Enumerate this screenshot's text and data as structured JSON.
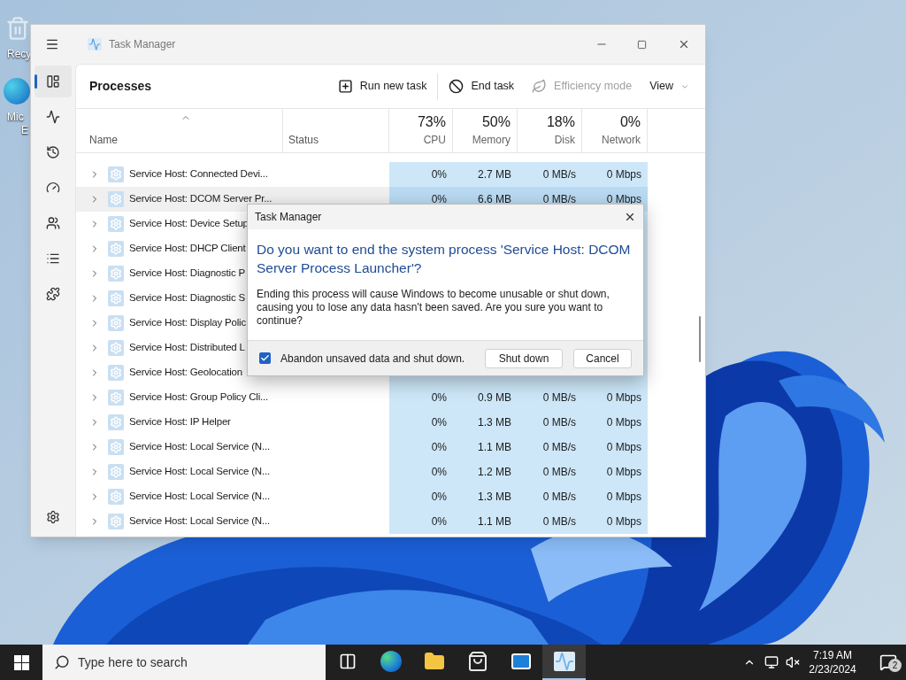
{
  "desktop": {
    "icons": [
      {
        "kind": "recycle",
        "lines": [
          "Recy"
        ]
      },
      {
        "kind": "edge",
        "lines": [
          "Mic",
          "E"
        ]
      }
    ]
  },
  "window": {
    "title": "Task Manager",
    "nav": [
      {
        "kind": "processes",
        "selected": true
      },
      {
        "kind": "performance",
        "selected": false
      },
      {
        "kind": "history",
        "selected": false
      },
      {
        "kind": "startup",
        "selected": false
      },
      {
        "kind": "users",
        "selected": false
      },
      {
        "kind": "details",
        "selected": false
      },
      {
        "kind": "services",
        "selected": false
      }
    ],
    "page_title": "Processes",
    "actions": [
      {
        "kind": "run",
        "label": "Run new task",
        "disabled": false
      },
      {
        "kind": "end",
        "label": "End task",
        "disabled": false
      },
      {
        "kind": "efficiency",
        "label": "Efficiency mode",
        "disabled": true
      },
      {
        "kind": "view",
        "label": "View",
        "disabled": false
      }
    ]
  },
  "table": {
    "columns": [
      {
        "label": "Name"
      },
      {
        "label": "Status"
      },
      {
        "percent": "73%",
        "label": "CPU"
      },
      {
        "percent": "50%",
        "label": "Memory"
      },
      {
        "percent": "18%",
        "label": "Disk"
      },
      {
        "percent": "0%",
        "label": "Network"
      }
    ],
    "rows": [
      {
        "name": "Service Host: Connected Devi...",
        "selected": false,
        "cpu": "0%",
        "memory": "2.7 MB",
        "disk": "0 MB/s",
        "network": "0 Mbps"
      },
      {
        "name": "Service Host: DCOM Server Pr...",
        "selected": true,
        "cpu": "0%",
        "memory": "6.6 MB",
        "disk": "0 MB/s",
        "network": "0 Mbps"
      },
      {
        "name": "Service Host: Device Setup",
        "selected": false
      },
      {
        "name": "Service Host: DHCP Client",
        "selected": false
      },
      {
        "name": "Service Host: Diagnostic P",
        "selected": false
      },
      {
        "name": "Service Host: Diagnostic S",
        "selected": false
      },
      {
        "name": "Service Host: Display Polic",
        "selected": false
      },
      {
        "name": "Service Host: Distributed L",
        "selected": false
      },
      {
        "name": "Service Host: Geolocation",
        "selected": false
      },
      {
        "name": "Service Host: Group Policy Cli...",
        "selected": false,
        "cpu": "0%",
        "memory": "0.9 MB",
        "disk": "0 MB/s",
        "network": "0 Mbps"
      },
      {
        "name": "Service Host: IP Helper",
        "selected": false,
        "cpu": "0%",
        "memory": "1.3 MB",
        "disk": "0 MB/s",
        "network": "0 Mbps"
      },
      {
        "name": "Service Host: Local Service (N...",
        "selected": false,
        "cpu": "0%",
        "memory": "1.1 MB",
        "disk": "0 MB/s",
        "network": "0 Mbps"
      },
      {
        "name": "Service Host: Local Service (N...",
        "selected": false,
        "cpu": "0%",
        "memory": "1.2 MB",
        "disk": "0 MB/s",
        "network": "0 Mbps"
      },
      {
        "name": "Service Host: Local Service (N...",
        "selected": false,
        "cpu": "0%",
        "memory": "1.3 MB",
        "disk": "0 MB/s",
        "network": "0 Mbps"
      },
      {
        "name": "Service Host: Local Service (N...",
        "selected": false,
        "cpu": "0%",
        "memory": "1.1 MB",
        "disk": "0 MB/s",
        "network": "0 Mbps"
      }
    ]
  },
  "dialog": {
    "title": "Task Manager",
    "heading": "Do you want to end the system process 'Service Host: DCOM Server Process Launcher'?",
    "message": "Ending this process will cause Windows to become unusable or shut down, causing you to lose any data hasn't been saved. Are you sure you want to continue?",
    "checkbox": {
      "label": "Abandon unsaved data and shut down.",
      "checked": true
    },
    "buttons": [
      "Shut down",
      "Cancel"
    ]
  },
  "taskbar": {
    "search_placeholder": "Type here to search",
    "apps": [
      {
        "kind": "taskview",
        "selected": false
      },
      {
        "kind": "edge",
        "selected": false
      },
      {
        "kind": "explorer",
        "selected": false
      },
      {
        "kind": "store",
        "selected": false
      },
      {
        "kind": "mail",
        "selected": false
      },
      {
        "kind": "taskmanager",
        "selected": true
      }
    ],
    "time": "7:19 AM",
    "date": "2/23/2024",
    "notifications": "2"
  }
}
